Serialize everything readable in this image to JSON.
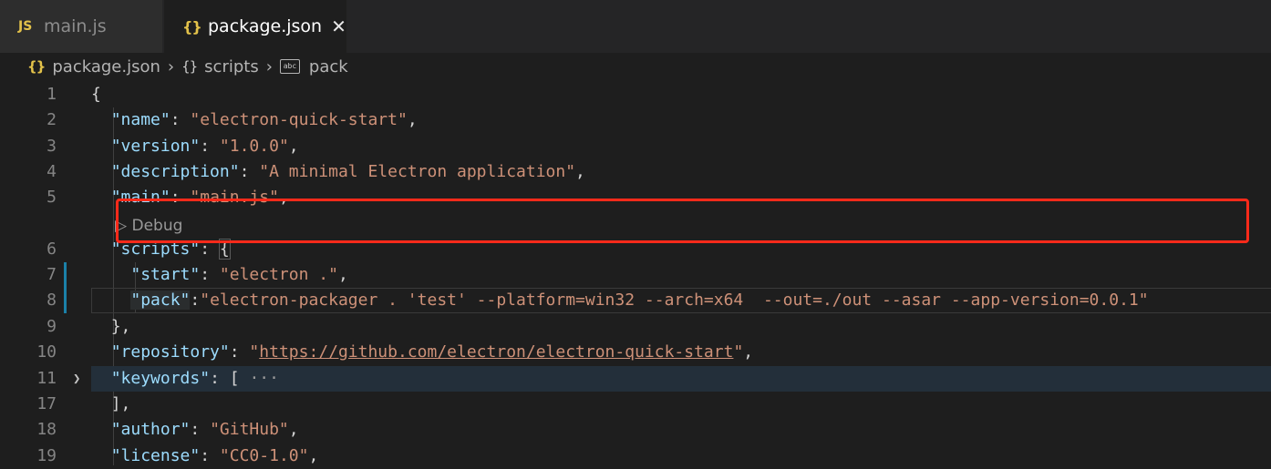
{
  "tabs": [
    {
      "icon_text": "JS",
      "label": "main.js",
      "active": false
    },
    {
      "icon_text": "{}",
      "label": "package.json",
      "active": true,
      "close": "✕"
    }
  ],
  "breadcrumb": {
    "items": [
      {
        "icon_text": "{}",
        "label": "package.json"
      },
      {
        "icon_text": "{}",
        "label": "scripts"
      },
      {
        "icon_text": "abc",
        "label": "pack"
      }
    ],
    "separator": "›"
  },
  "codelens": "▷ Debug",
  "lines": [
    {
      "num": "1"
    },
    {
      "num": "2"
    },
    {
      "num": "3"
    },
    {
      "num": "4"
    },
    {
      "num": "5"
    },
    {
      "num": "6"
    },
    {
      "num": "7"
    },
    {
      "num": "8"
    },
    {
      "num": "9"
    },
    {
      "num": "10"
    },
    {
      "num": "11"
    },
    {
      "num": "17"
    },
    {
      "num": "18"
    },
    {
      "num": "19"
    }
  ],
  "code": {
    "l1": "{",
    "name_key": "\"name\"",
    "name_val": "\"electron-quick-start\"",
    "version_key": "\"version\"",
    "version_val": "\"1.0.0\"",
    "description_key": "\"description\"",
    "description_val": "\"A minimal Electron application\"",
    "main_key": "\"main\"",
    "main_val": "\"main.js\"",
    "scripts_key": "\"scripts\"",
    "scripts_open": "{",
    "start_key": "\"start\"",
    "start_val": "\"electron .\"",
    "pack_key": "\"pack\"",
    "pack_val": "\"electron-packager . 'test' --platform=win32 --arch=x64  --out=./out --asar --app-version=0.0.1\"",
    "scripts_close": "},",
    "repository_key": "\"repository\"",
    "repository_q1": "\"",
    "repository_url": "https://github.com/electron/electron-quick-start",
    "repository_q2": "\"",
    "keywords_key": "\"keywords\"",
    "keywords_open": "[",
    "keywords_ellipsis": "···",
    "keywords_close": "],",
    "author_key": "\"author\"",
    "author_val": "\"GitHub\"",
    "license_key": "\"license\"",
    "license_val": "\"CC0-1.0\""
  },
  "colors": {
    "background": "#1e1e1e",
    "key": "#9cdcfe",
    "string": "#ce9178",
    "highlight_box": "#ff2a1a",
    "js_icon": "#e3c24a"
  }
}
